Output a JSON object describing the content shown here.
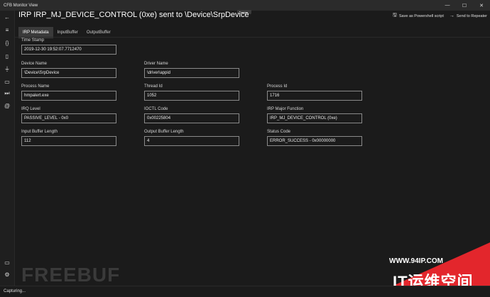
{
  "window": {
    "title": "CFB Monitor View",
    "minimize_glyph": "—",
    "maximize_glyph": "☐",
    "close_glyph": "✕"
  },
  "rail": {
    "icons": [
      {
        "name": "back-arrow-icon",
        "glyph": "←"
      },
      {
        "name": "hamburger-menu-icon",
        "glyph": "≡"
      },
      {
        "name": "braces-icon",
        "glyph": "{}"
      },
      {
        "name": "document-icon",
        "glyph": "▯"
      },
      {
        "name": "plug-icon",
        "glyph": "⏚"
      },
      {
        "name": "note-icon",
        "glyph": "▭"
      },
      {
        "name": "step-forward-icon",
        "glyph": "⏭"
      },
      {
        "name": "at-sign-icon",
        "glyph": "@"
      }
    ],
    "bottom_icons": [
      {
        "name": "message-icon",
        "glyph": "▭"
      },
      {
        "name": "gear-icon",
        "glyph": "⚙"
      }
    ]
  },
  "header": {
    "title": "IRP IRP_MJ_DEVICE_CONTROL (0xe) sent to \\Device\\SrpDevice",
    "actions": [
      {
        "label": "Save as Powershell script",
        "glyph": "🖫"
      },
      {
        "label": "Send to Repeater",
        "glyph": "→"
      }
    ]
  },
  "tabs": [
    "IRP Metadata",
    "InputBuffer",
    "OutputBuffer"
  ],
  "fields": {
    "time_stamp": {
      "label": "Time Stamp",
      "value": "2019-12-30 19:52:07.7712470"
    },
    "device_name": {
      "label": "Device Name",
      "value": "\\Device\\SrpDevice"
    },
    "driver_name": {
      "label": "Driver Name",
      "value": "\\driver\\appid"
    },
    "process_name": {
      "label": "Process Name",
      "value": "hmpalert.exe"
    },
    "thread_id": {
      "label": "Thread Id",
      "value": "1052"
    },
    "process_id": {
      "label": "Process Id",
      "value": "1716"
    },
    "irq_level": {
      "label": "IRQ Level",
      "value": "PASSIVE_LEVEL - 0x0"
    },
    "ioctl_code": {
      "label": "IOCTL Code",
      "value": "0x00225804"
    },
    "irp_major_function": {
      "label": "IRP Major Function",
      "value": "IRP_MJ_DEVICE_CONTROL (0xe)"
    },
    "input_buffer_length": {
      "label": "Input Buffer Length",
      "value": "112"
    },
    "output_buffer_length": {
      "label": "Output Buffer Length",
      "value": "4"
    },
    "status_code": {
      "label": "Status Code",
      "value": "ERROR_SUCCESS - 0x00000000"
    }
  },
  "status": {
    "text": "Capturing..."
  },
  "watermark": {
    "freebuf": "FREEBUF",
    "url": "WWW.94IP.COM",
    "cn": "IT运维空间"
  },
  "colors": {
    "background": "#1b1b1b",
    "watermark_red": "#e3262c"
  }
}
